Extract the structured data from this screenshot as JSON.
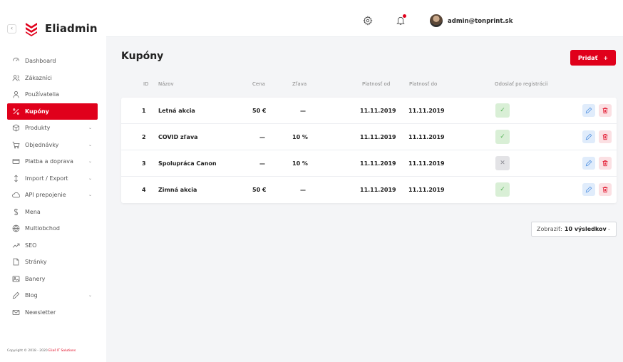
{
  "brand": {
    "name": "Eliadmin",
    "collapse_glyph": "‹"
  },
  "sidebar": {
    "items": [
      {
        "label": "Dashboard",
        "icon": "dashboard-icon",
        "caret": ""
      },
      {
        "label": "Zákazníci",
        "icon": "customers-icon",
        "caret": ""
      },
      {
        "label": "Používatelia",
        "icon": "user-icon",
        "caret": ""
      },
      {
        "label": "Kupóny",
        "icon": "percent-icon",
        "caret": "",
        "active": true
      },
      {
        "label": "Produkty",
        "icon": "box-icon",
        "caret": "⌄"
      },
      {
        "label": "Objednávky",
        "icon": "cart-icon",
        "caret": "⌄"
      },
      {
        "label": "Platba a doprava",
        "icon": "card-icon",
        "caret": "⌄"
      },
      {
        "label": "Import / Export",
        "icon": "import-export-icon",
        "caret": "⌄"
      },
      {
        "label": "API prepojenie",
        "icon": "cloud-icon",
        "caret": "⌄"
      },
      {
        "label": "Mena",
        "icon": "currency-icon",
        "caret": ""
      },
      {
        "label": "Multiobchod",
        "icon": "globe-icon",
        "caret": ""
      },
      {
        "label": "SEO",
        "icon": "trend-icon",
        "caret": ""
      },
      {
        "label": "Stránky",
        "icon": "page-icon",
        "caret": ""
      },
      {
        "label": "Banery",
        "icon": "image-icon",
        "caret": ""
      },
      {
        "label": "Blog",
        "icon": "pen-icon",
        "caret": "⌄"
      },
      {
        "label": "Newsletter",
        "icon": "mail-icon",
        "caret": ""
      }
    ],
    "copyright_prefix": "Copyright © 2018 - 2020 ",
    "copyright_link": "Eliaš IT Solutions"
  },
  "topbar": {
    "user_email": "admin@tonprint.sk",
    "user_caret": "⌄"
  },
  "page": {
    "title": "Kupóny",
    "add_label": "Pridať",
    "add_plus": "+"
  },
  "table": {
    "headers": {
      "id": "ID",
      "name": "Názov",
      "price": "Cena",
      "discount": "Zľava",
      "valid_from": "Platnosť od",
      "valid_to": "Platnosť do",
      "send": "Odoslať po registrácii"
    },
    "rows": [
      {
        "id": "1",
        "name": "Letná akcia",
        "price": "50 €",
        "discount": "—",
        "valid_from": "11.11.2019",
        "valid_to": "11.11.2019",
        "send_glyph": "✓",
        "send": true
      },
      {
        "id": "2",
        "name": "COVID zľava",
        "price": "—",
        "discount": "10 %",
        "valid_from": "11.11.2019",
        "valid_to": "11.11.2019",
        "send_glyph": "✓",
        "send": true
      },
      {
        "id": "3",
        "name": "Spolupráca Canon",
        "price": "—",
        "discount": "10 %",
        "valid_from": "11.11.2019",
        "valid_to": "11.11.2019",
        "send_glyph": "✕",
        "send": false
      },
      {
        "id": "4",
        "name": "Zimná akcia",
        "price": "50 €",
        "discount": "—",
        "valid_from": "11.11.2019",
        "valid_to": "11.11.2019",
        "send_glyph": "✓",
        "send": true
      }
    ]
  },
  "pagination": {
    "label": "Zobraziť:",
    "value": "10 výsledkov",
    "caret": "⌄"
  },
  "colors": {
    "accent": "#e0001b",
    "success_bg": "#d9efd6",
    "edit_bg": "#e0ecfb",
    "delete_bg": "#fbe0e3"
  }
}
